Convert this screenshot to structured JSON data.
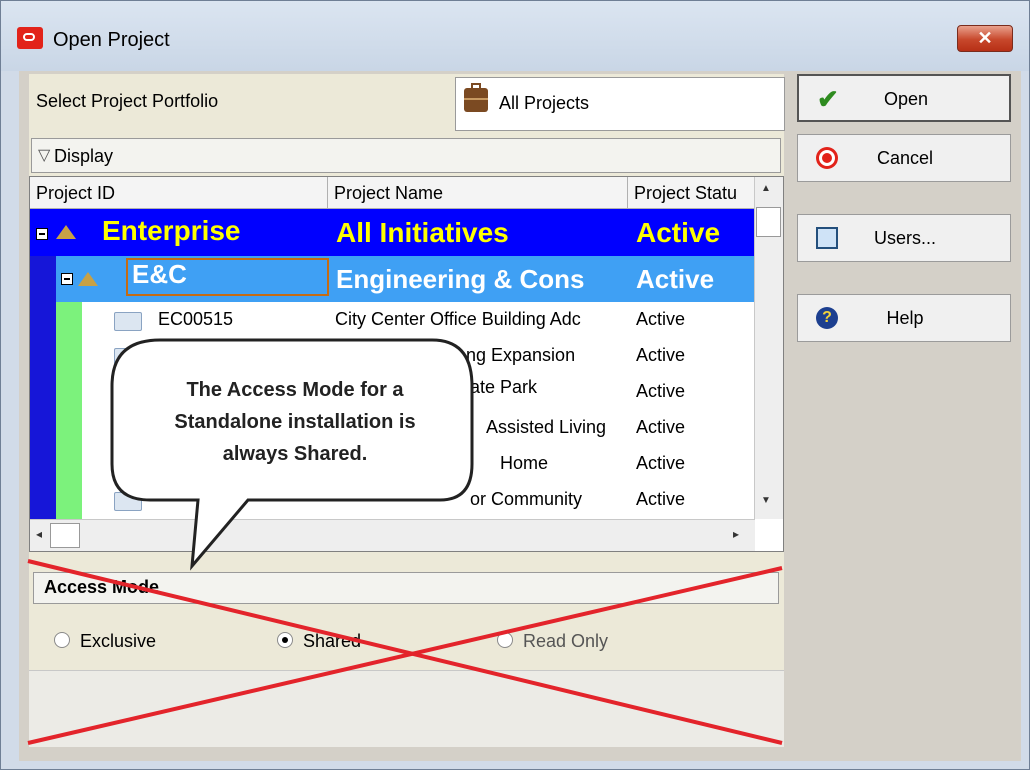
{
  "window": {
    "title": "Open Project",
    "close_glyph": "✕"
  },
  "portfolio": {
    "label": "Select Project Portfolio",
    "value": "All Projects"
  },
  "display": {
    "label": "Display",
    "toggle_glyph": "▽"
  },
  "grid": {
    "columns": [
      "Project ID",
      "Project Name",
      "Project Statu"
    ],
    "rows": [
      {
        "id": "Enterprise",
        "name": "All  Initiatives",
        "status": "Active"
      },
      {
        "id": "E&C",
        "name": "Engineering & Cons",
        "status": "Active"
      },
      {
        "id": "EC00515",
        "name": "City Center Office Building Adc",
        "status": "Active"
      },
      {
        "id": "",
        "name": "ng Expansion",
        "status": "Active"
      },
      {
        "id": "",
        "name": "ate Park",
        "status": "Active"
      },
      {
        "id": "",
        "name": "Assisted Living",
        "status": "Active"
      },
      {
        "id": "",
        "name": "Home",
        "status": "Active"
      },
      {
        "id": "",
        "name": "or Community",
        "status": "Active"
      }
    ],
    "scroll_up": "▲",
    "scroll_down": "▼",
    "scroll_left": "◂",
    "scroll_right": "▸"
  },
  "access_mode": {
    "header": "Access Mode",
    "options": [
      "Exclusive",
      "Shared",
      "Read Only"
    ],
    "selected": "Shared"
  },
  "buttons": {
    "open": "Open",
    "cancel": "Cancel",
    "users": "Users...",
    "help": "Help"
  },
  "callout": {
    "text_line1": "The Access Mode for a",
    "text_line2": "Standalone installation is",
    "text_line3": "always Shared."
  },
  "colors": {
    "row_enterprise_bg": "#0000ff",
    "row_ec_bg": "#3fa0f4",
    "row_highlight_text": "#ffff00",
    "cross_red": "#e3242b",
    "indent_blue": "#1616d8",
    "indent_green": "#7cf27c"
  }
}
